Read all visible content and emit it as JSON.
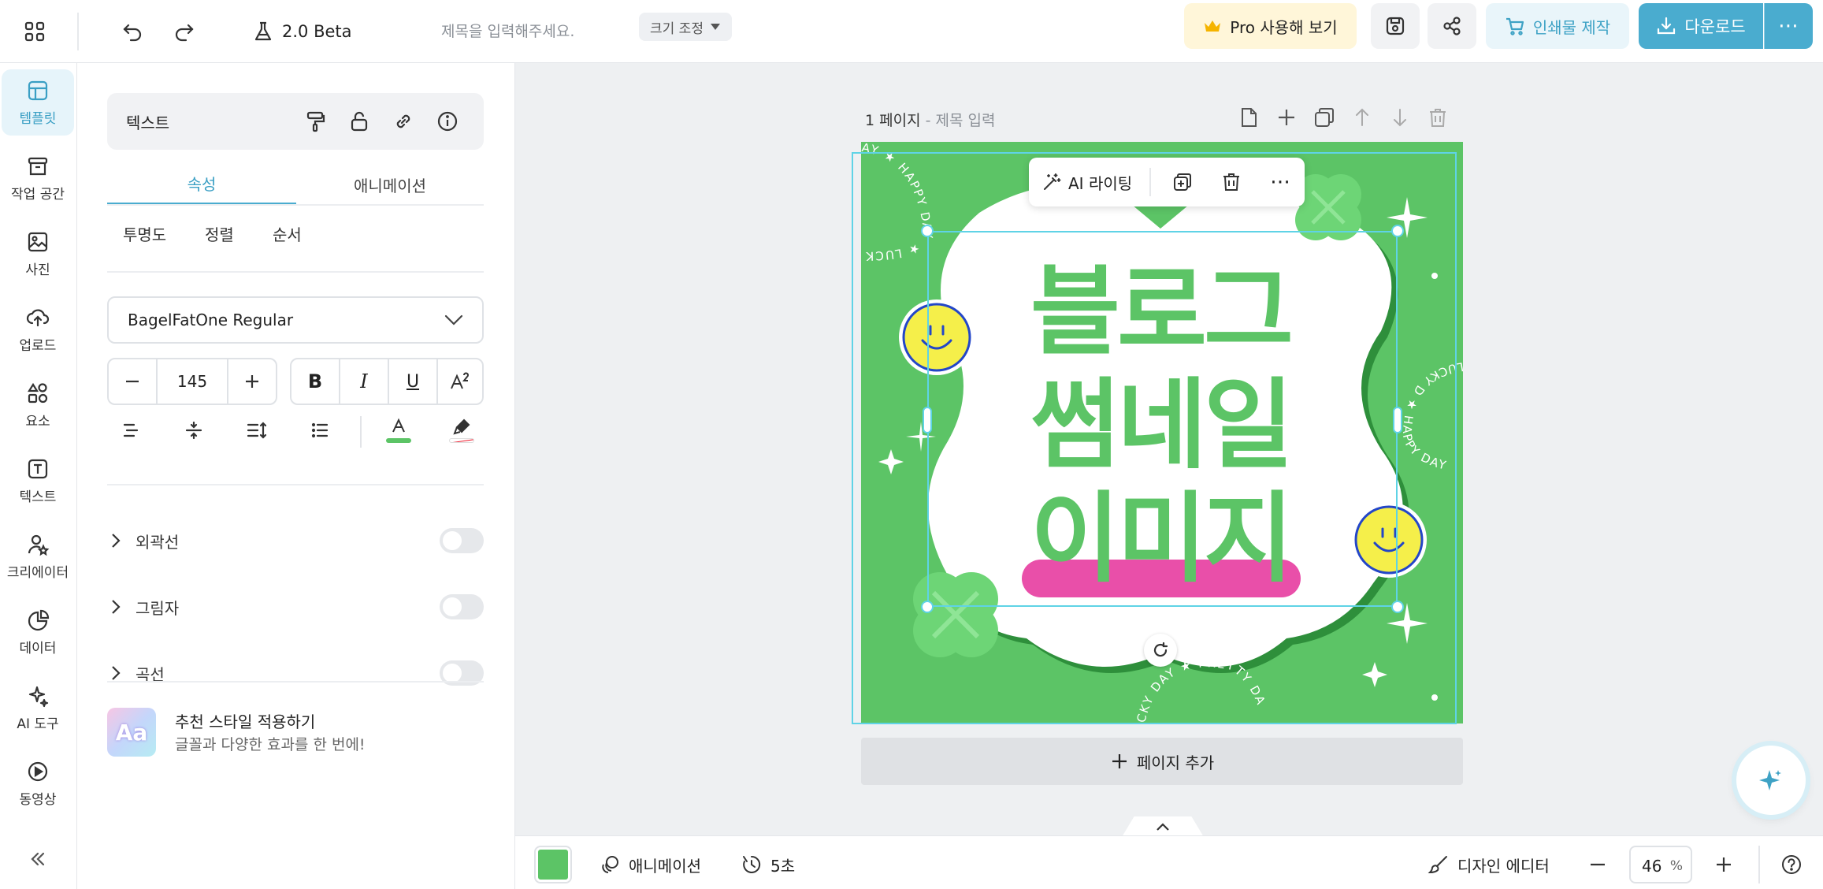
{
  "topbar": {
    "version": "2.0 Beta",
    "title_placeholder": "제목을 입력해주세요.",
    "resize_label": "크기 조정",
    "pro_label": "Pro 사용해 보기",
    "print_label": "인쇄물 제작",
    "download_label": "다운로드"
  },
  "leftnav": {
    "items": [
      {
        "label": "템플릿",
        "icon": "template-icon"
      },
      {
        "label": "작업 공간",
        "icon": "workspace-icon"
      },
      {
        "label": "사진",
        "icon": "photo-icon"
      },
      {
        "label": "업로드",
        "icon": "upload-icon"
      },
      {
        "label": "요소",
        "icon": "elements-icon"
      },
      {
        "label": "텍스트",
        "icon": "text-icon"
      },
      {
        "label": "크리에이터",
        "icon": "creator-icon"
      },
      {
        "label": "데이터",
        "icon": "data-icon"
      },
      {
        "label": "AI 도구",
        "icon": "ai-tools-icon"
      },
      {
        "label": "동영상",
        "icon": "video-icon"
      }
    ]
  },
  "panel": {
    "header": "텍스트",
    "tabs": [
      "속성",
      "애니메이션"
    ],
    "subtabs": [
      "투명도",
      "정렬",
      "순서"
    ],
    "font": "BagelFatOne Regular",
    "font_size": "145",
    "text_color": "#5cc466",
    "toggles": [
      "외곽선",
      "그림자",
      "곡선"
    ],
    "recommend_title": "추천 스타일 적용하기",
    "recommend_desc": "글꼴과 다양한 효과를 한 번에!",
    "recommend_badge": "Aa"
  },
  "canvas": {
    "page_label": "1 페이지",
    "page_title_placeholder": "- 제목 입력",
    "add_page": "페이지 추가",
    "design": {
      "lines": [
        "블로그",
        "썸네일",
        "이미지"
      ],
      "curve_text_1": "AY ★ HAPPY DAY ★ LUCK",
      "curve_text_2": "LUCKY D ★ HAPPY DAY",
      "curve_text_3": "CKY DAY ★ PRETTY DA",
      "bg_color": "#5cc466",
      "highlight_color": "#e94fa9"
    },
    "float_bar": {
      "ai_label": "AI 라이팅"
    }
  },
  "bottombar": {
    "bg_color": "#5cc466",
    "animation_label": "애니메이션",
    "duration": "5초",
    "design_editor": "디자인 에디터",
    "zoom": "46",
    "zoom_unit": "%"
  }
}
